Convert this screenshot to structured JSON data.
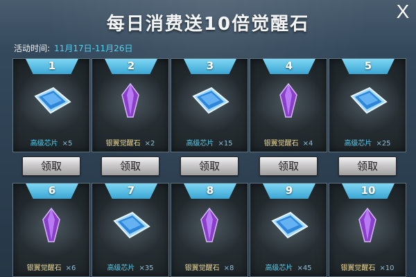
{
  "header": {
    "title": "每日消费送10倍觉醒石",
    "close_label": "X"
  },
  "event": {
    "date_label": "活动时间:",
    "date_range": "11月17日-11月26日"
  },
  "colors": {
    "accent_cyan": "#4fd3f5",
    "crystal_name": "#f0d890",
    "badge": "#3aa6d4"
  },
  "claim_label": "领取",
  "rewards": [
    {
      "number": "1",
      "icon": "chip-icon",
      "name": "高级芯片",
      "qty": "×5"
    },
    {
      "number": "2",
      "icon": "crystal-icon",
      "name": "银翼觉醒石",
      "qty": "×2"
    },
    {
      "number": "3",
      "icon": "chip-icon",
      "name": "高级芯片",
      "qty": "×15"
    },
    {
      "number": "4",
      "icon": "crystal-icon",
      "name": "银翼觉醒石",
      "qty": "×4"
    },
    {
      "number": "5",
      "icon": "chip-icon",
      "name": "高级芯片",
      "qty": "×25"
    },
    {
      "number": "6",
      "icon": "crystal-icon",
      "name": "银翼觉醒石",
      "qty": "×6"
    },
    {
      "number": "7",
      "icon": "chip-icon",
      "name": "高级芯片",
      "qty": "×35"
    },
    {
      "number": "8",
      "icon": "crystal-icon",
      "name": "银翼觉醒石",
      "qty": "×8"
    },
    {
      "number": "9",
      "icon": "chip-icon",
      "name": "高级芯片",
      "qty": "×45"
    },
    {
      "number": "10",
      "icon": "crystal-icon",
      "name": "银翼觉醒石",
      "qty": "×10"
    }
  ]
}
